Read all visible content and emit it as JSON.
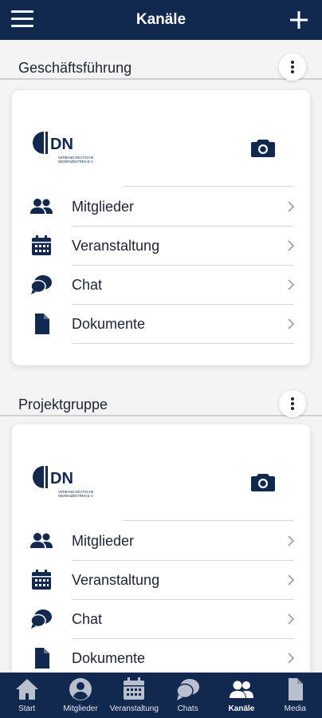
{
  "topbar": {
    "title": "Kanäle",
    "menu_icon": "hamburger-icon",
    "add_icon": "plus-icon"
  },
  "colors": {
    "primary": "#11284f",
    "text": "#1e2235",
    "divider": "#d8d8dc",
    "background": "#f4f4f4"
  },
  "channels": [
    {
      "name": "Geschäftsführung",
      "logo": {
        "letters": "DN",
        "line1": "VERBAND DEUTSCHE",
        "line2": "NIERENZENTREN E.V."
      },
      "items": [
        {
          "label": "Mitglieder",
          "icon": "users-icon"
        },
        {
          "label": "Veranstaltung",
          "icon": "calendar-icon"
        },
        {
          "label": "Chat",
          "icon": "chat-icon"
        },
        {
          "label": "Dokumente",
          "icon": "document-icon"
        }
      ]
    },
    {
      "name": "Projektgruppe",
      "logo": {
        "letters": "DN",
        "line1": "VERBAND DEUTSCHE",
        "line2": "NIERENZENTREN E.V."
      },
      "items": [
        {
          "label": "Mitglieder",
          "icon": "users-icon"
        },
        {
          "label": "Veranstaltung",
          "icon": "calendar-icon"
        },
        {
          "label": "Chat",
          "icon": "chat-icon"
        },
        {
          "label": "Dokumente",
          "icon": "document-icon"
        }
      ]
    }
  ],
  "bottom_nav": [
    {
      "label": "Start",
      "icon": "home-icon",
      "active": false
    },
    {
      "label": "Mitglieder",
      "icon": "user-circle-icon",
      "active": false
    },
    {
      "label": "Veranstaltung",
      "icon": "calendar-icon",
      "active": false
    },
    {
      "label": "Chats",
      "icon": "chat-icon",
      "active": false
    },
    {
      "label": "Kanäle",
      "icon": "users-icon",
      "active": true
    },
    {
      "label": "Media",
      "icon": "document-icon",
      "active": false
    }
  ]
}
